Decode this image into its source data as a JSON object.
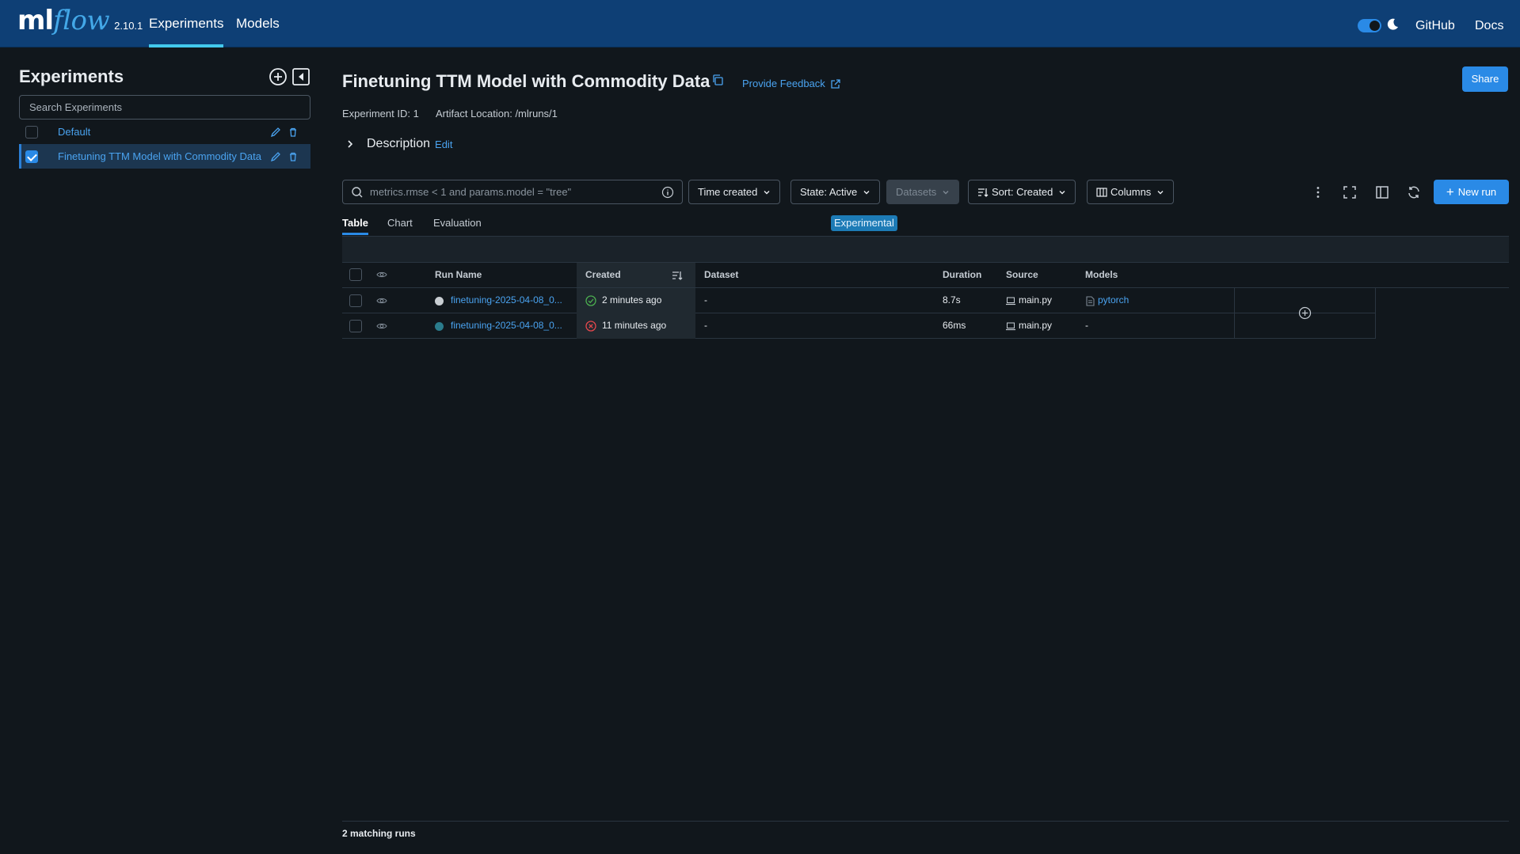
{
  "topbar": {
    "logo_ml": "ml",
    "logo_flow": "flow",
    "version": "2.10.1",
    "nav": [
      "Experiments",
      "Models"
    ],
    "links": [
      "GitHub",
      "Docs"
    ],
    "accent": "#43c9ed"
  },
  "sidebar": {
    "title": "Experiments",
    "search_placeholder": "Search Experiments",
    "items": [
      {
        "label": "Default",
        "checked": false
      },
      {
        "label": "Finetuning TTM Model with Commodity Data",
        "checked": true
      }
    ]
  },
  "experiment": {
    "title": "Finetuning TTM Model with Commodity Data",
    "feedback": "Provide Feedback",
    "share": "Share",
    "id_text": "Experiment ID: 1",
    "artifact_text": "Artifact Location: /mlruns/1",
    "description_label": "Description",
    "description_edit": "Edit"
  },
  "controls": {
    "filter_placeholder": "metrics.rmse < 1 and params.model = \"tree\"",
    "time_created": "Time created",
    "state": "State: Active",
    "datasets": "Datasets",
    "sort": "Sort: Created",
    "columns": "Columns",
    "new_run": "New run"
  },
  "tabs": [
    "Table",
    "Chart",
    "Evaluation"
  ],
  "experimental_badge": "Experimental",
  "table": {
    "headers": [
      "Run Name",
      "Created",
      "Dataset",
      "Duration",
      "Source",
      "Models"
    ],
    "rows": [
      {
        "name": "finetuning-2025-04-08_0...",
        "status": "finished",
        "status_color": "#4caf50",
        "dot_color": "#c9ced3",
        "created": "2 minutes ago",
        "dataset": "-",
        "duration": "8.7s",
        "source": "main.py",
        "model": "pytorch"
      },
      {
        "name": "finetuning-2025-04-08_0...",
        "status": "failed",
        "status_color": "#e5484d",
        "dot_color": "#2b7c8c",
        "created": "11 minutes ago",
        "dataset": "-",
        "duration": "66ms",
        "source": "main.py",
        "model": "-"
      }
    ]
  },
  "footer": {
    "matching": "2 matching runs"
  }
}
